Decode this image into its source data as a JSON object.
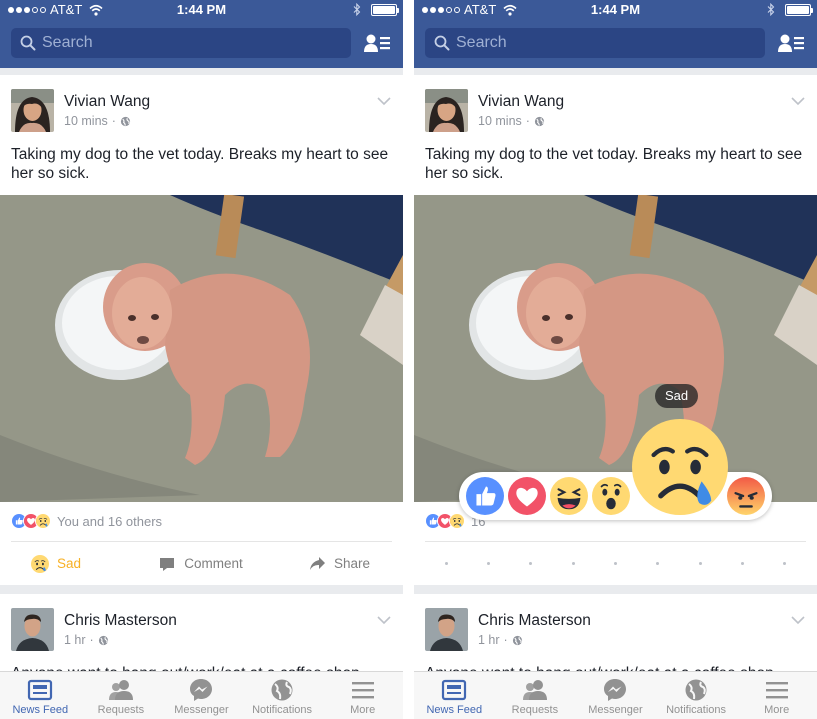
{
  "colors": {
    "facebook_blue": "#3b5998",
    "search_field": "#2b4584",
    "sad_yellow": "#f7b125",
    "text_primary": "#1d2129",
    "text_secondary": "#90949c",
    "nav_active": "#4267b2"
  },
  "status_bar": {
    "carrier": "AT&T",
    "time": "1:44 PM",
    "icons": [
      "signal-dots-icon",
      "wifi-icon",
      "bluetooth-icon",
      "battery-icon"
    ]
  },
  "header": {
    "search_placeholder": "Search",
    "icons": [
      "search-icon",
      "friend-list-icon"
    ]
  },
  "post": {
    "author": "Vivian Wang",
    "time": "10 mins",
    "text": "Taking my dog to the vet today. Breaks my heart to see her so sick.",
    "reactions_summary": {
      "icons": [
        "like-icon",
        "love-icon",
        "sad-icon"
      ],
      "text": "You and 16 others",
      "partial_count": "16"
    },
    "actions": {
      "reacted_label": "Sad",
      "comment_label": "Comment",
      "share_label": "Share"
    }
  },
  "reaction_picker": {
    "reactions": [
      "like",
      "love",
      "haha",
      "wow",
      "sad",
      "angry"
    ],
    "selected": "sad",
    "tooltip": "Sad"
  },
  "second_post": {
    "author": "Chris Masterson",
    "time": "1 hr",
    "partial_text": "Anyone want to hang out/work/eat at a coffee shop"
  },
  "bottom_nav": {
    "items": [
      {
        "label": "News Feed",
        "icon": "news-feed-icon",
        "active": true
      },
      {
        "label": "Requests",
        "icon": "requests-icon",
        "active": false
      },
      {
        "label": "Messenger",
        "icon": "messenger-icon",
        "active": false
      },
      {
        "label": "Notifications",
        "icon": "globe-icon",
        "active": false
      },
      {
        "label": "More",
        "icon": "menu-icon",
        "active": false
      }
    ]
  }
}
